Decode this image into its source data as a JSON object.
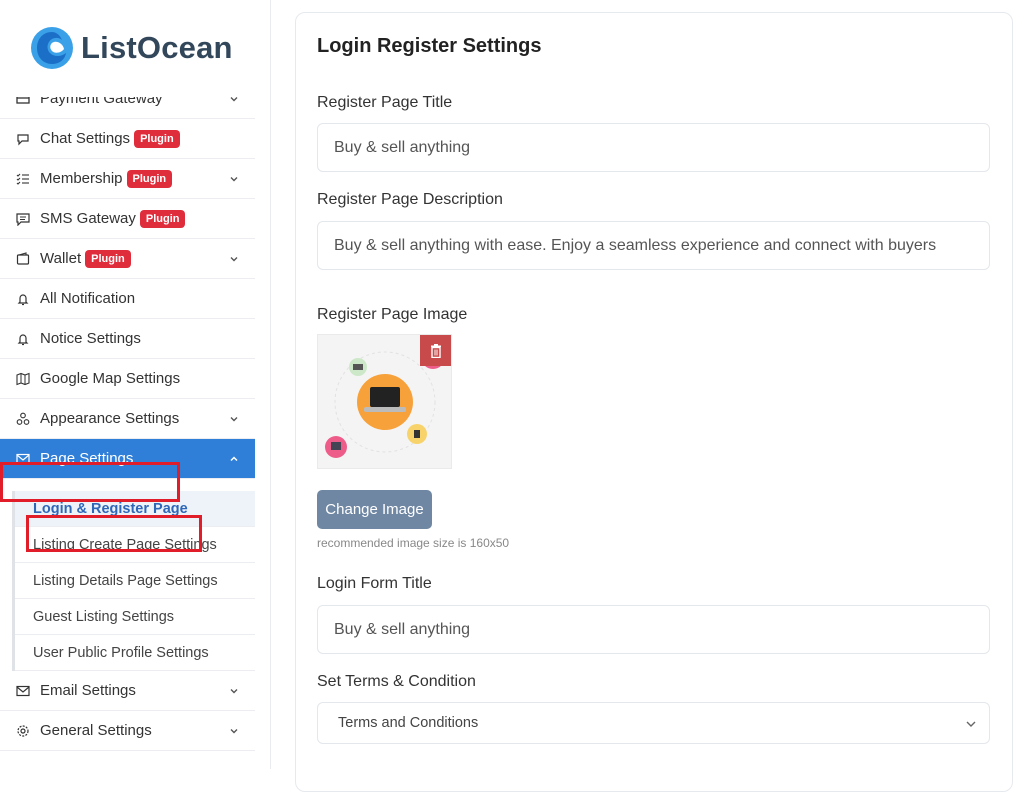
{
  "brand": {
    "name": "ListOcean",
    "accent": "#2f7ed8"
  },
  "sidebar": {
    "items": [
      {
        "label": "Payment Gateway",
        "icon": "wallet-card-icon",
        "badge": "",
        "has_chevron": true
      },
      {
        "label": "Chat Settings",
        "icon": "chat-bubble-icon",
        "badge": "Plugin",
        "has_chevron": false
      },
      {
        "label": "Membership",
        "icon": "checklist-icon",
        "badge": "Plugin",
        "has_chevron": true
      },
      {
        "label": "SMS Gateway",
        "icon": "message-square-icon",
        "badge": "Plugin",
        "has_chevron": false
      },
      {
        "label": "Wallet",
        "icon": "wallet-icon",
        "badge": "Plugin",
        "has_chevron": true
      },
      {
        "label": "All Notification",
        "icon": "bell-icon",
        "badge": "",
        "has_chevron": false
      },
      {
        "label": "Notice Settings",
        "icon": "bell-icon",
        "badge": "",
        "has_chevron": false
      },
      {
        "label": "Google Map Settings",
        "icon": "map-icon",
        "badge": "",
        "has_chevron": false
      },
      {
        "label": "Appearance Settings",
        "icon": "shapes-icon",
        "badge": "",
        "has_chevron": true
      },
      {
        "label": "Page Settings",
        "icon": "envelope-icon",
        "badge": "",
        "has_chevron": true,
        "active": true
      }
    ],
    "page_settings_sub": [
      {
        "label": "Login & Register Page",
        "current": true
      },
      {
        "label": "Listing Create Page Settings"
      },
      {
        "label": "Listing Details Page Settings"
      },
      {
        "label": "Guest Listing Settings"
      },
      {
        "label": "User Public Profile Settings"
      }
    ],
    "bottom_items": [
      {
        "label": "Email Settings",
        "icon": "envelope-icon",
        "has_chevron": true
      },
      {
        "label": "General Settings",
        "icon": "gear-icon",
        "has_chevron": true
      }
    ]
  },
  "main": {
    "title": "Login Register Settings",
    "register_title": {
      "label": "Register Page Title",
      "value": "Buy & sell anything"
    },
    "register_desc": {
      "label": "Register Page Description",
      "value": "Buy & sell anything with ease. Enjoy a seamless experience and connect with buyers"
    },
    "register_image": {
      "label": "Register Page Image",
      "button": "Change Image",
      "hint": "recommended image size is 160x50"
    },
    "login_title": {
      "label": "Login Form Title",
      "value": "Buy & sell anything"
    },
    "terms": {
      "label": "Set Terms & Condition",
      "selected": "Terms and Conditions"
    }
  }
}
